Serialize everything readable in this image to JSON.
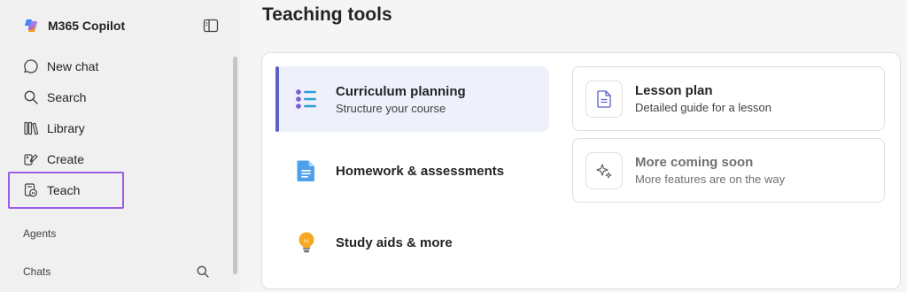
{
  "sidebar": {
    "brand": "M365 Copilot",
    "items": [
      {
        "label": "New chat",
        "icon": "chat-bubble-icon"
      },
      {
        "label": "Search",
        "icon": "search-icon"
      },
      {
        "label": "Library",
        "icon": "library-icon"
      },
      {
        "label": "Create",
        "icon": "create-icon"
      },
      {
        "label": "Teach",
        "icon": "teach-icon"
      }
    ],
    "sections": {
      "agents": "Agents",
      "chats": "Chats"
    }
  },
  "main": {
    "title": "Teaching tools",
    "tools": [
      {
        "title": "Curriculum planning",
        "subtitle": "Structure your course",
        "icon": "list-icon"
      },
      {
        "title": "Homework & assessments",
        "icon": "document-icon"
      },
      {
        "title": "Study aids & more",
        "icon": "lightbulb-icon"
      }
    ],
    "cards": [
      {
        "title": "Lesson plan",
        "subtitle": "Detailed guide for a lesson",
        "icon": "lesson-plan-icon"
      },
      {
        "title": "More coming soon",
        "subtitle": "More features are on the way",
        "icon": "sparkle-icon"
      }
    ]
  },
  "colors": {
    "accent": "#5b5fc7",
    "highlight": "#9b5de5"
  }
}
